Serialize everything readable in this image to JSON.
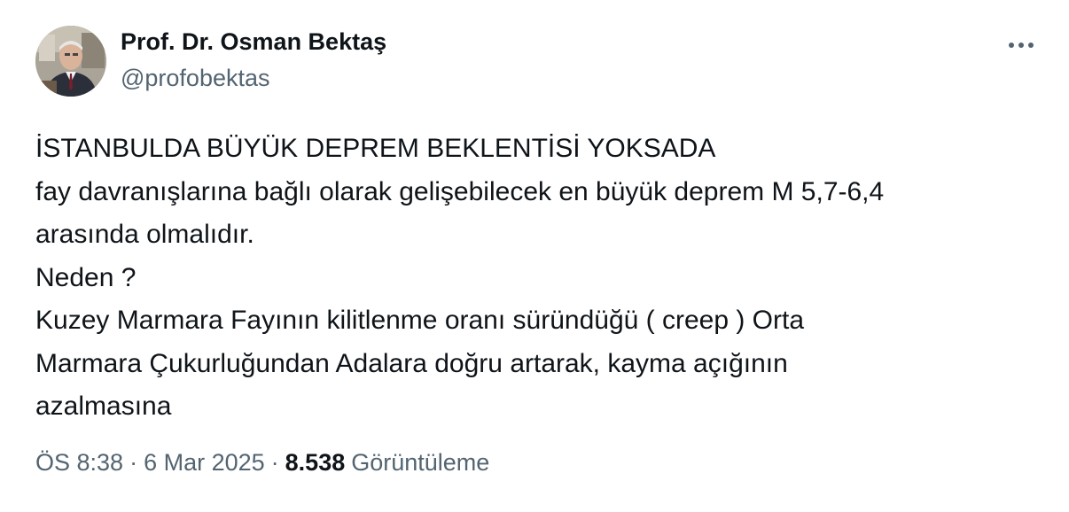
{
  "author": {
    "name": "Prof. Dr. Osman Bektaş",
    "handle": "@profobektas",
    "avatar_icon": "profile-photo"
  },
  "more_icon": "more-horizontal-icon",
  "tweet": {
    "lines": [
      "İSTANBULDA BÜYÜK DEPREM BEKLENTİSİ YOKSADA",
      "fay davranışlarına bağlı olarak gelişebilecek en büyük deprem M 5,7-6,4",
      "arasında olmalıdır.",
      "Neden ?",
      "Kuzey Marmara Fayının kilitlenme oranı süründüğü ( creep ) Orta",
      "Marmara Çukurluğundan Adalara doğru artarak, kayma açığının",
      "azalmasına"
    ]
  },
  "meta": {
    "time": "ÖS 8:38",
    "separator": "·",
    "date": "6 Mar 2025",
    "views_count": "8.538",
    "views_label": "Görüntüleme"
  },
  "colors": {
    "text_primary": "#0f1419",
    "text_secondary": "#536471",
    "background": "#ffffff"
  }
}
